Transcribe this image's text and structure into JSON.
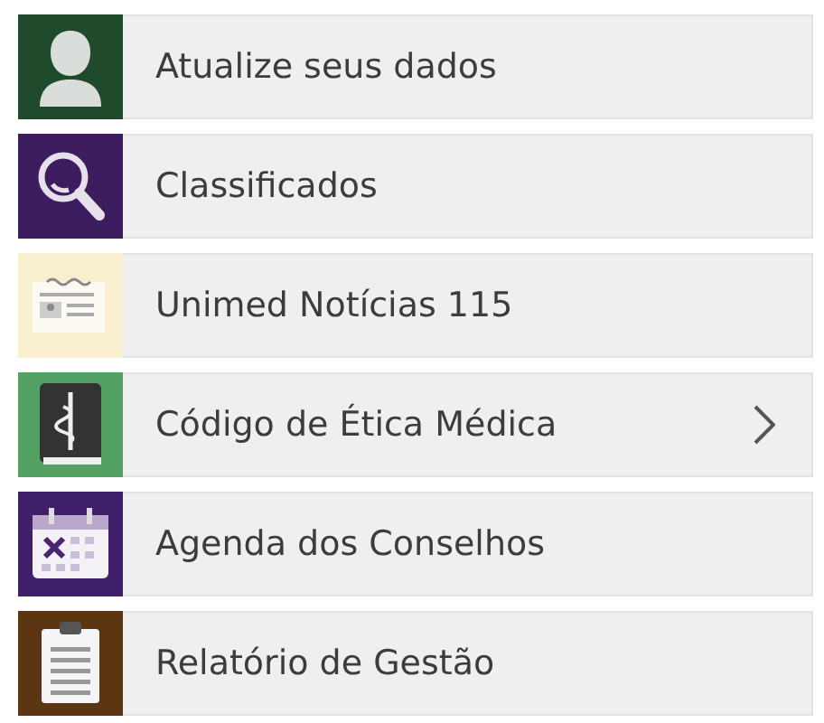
{
  "menu": [
    {
      "label": "Atualize seus dados",
      "kind": "person",
      "color": "#1f4a2b",
      "has_submenu": false
    },
    {
      "label": "Classificados",
      "kind": "search",
      "color": "#3e1c60",
      "has_submenu": false
    },
    {
      "label": "Unimed Notícias 115",
      "kind": "newspaper",
      "color": "#f7efcd",
      "has_submenu": false
    },
    {
      "label": "Código de Ética Médica",
      "kind": "book",
      "color": "#53a063",
      "has_submenu": true
    },
    {
      "label": "Agenda dos Conselhos",
      "kind": "calendar",
      "color": "#41206a",
      "has_submenu": false
    },
    {
      "label": "Relatório de Gestão",
      "kind": "clipboard",
      "color": "#5c3512",
      "has_submenu": false
    }
  ]
}
